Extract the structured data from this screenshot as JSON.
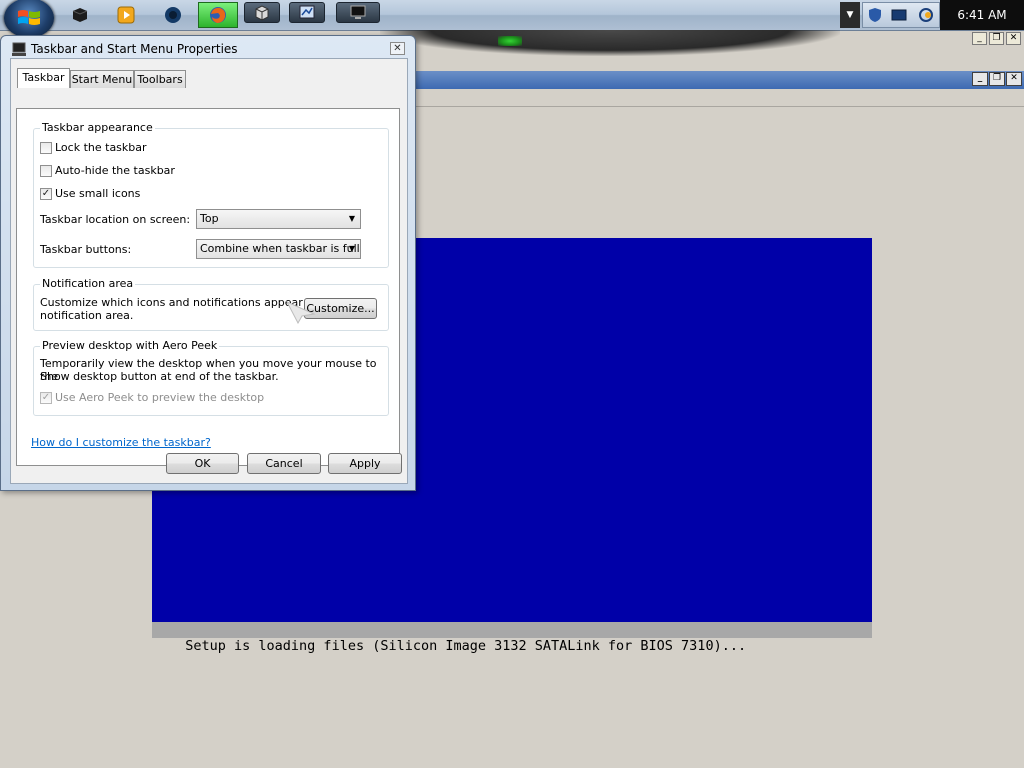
{
  "taskbar": {
    "clock": "6:41 AM",
    "icons": [
      {
        "name": "virtualbox-icon"
      },
      {
        "name": "media-player-icon"
      },
      {
        "name": "firefox-icon"
      },
      {
        "name": "network-monitor-icon"
      }
    ]
  },
  "dialog": {
    "title": "Taskbar and Start Menu Properties",
    "tabs": [
      "Taskbar",
      "Start Menu",
      "Toolbars"
    ],
    "active_tab": "Taskbar",
    "appearance": {
      "title": "Taskbar appearance",
      "lock_label": "Lock the taskbar",
      "lock_checked": false,
      "autohide_label": "Auto-hide the taskbar",
      "autohide_checked": false,
      "small_icons_label": "Use small icons",
      "small_icons_checked": true,
      "location_label": "Taskbar location on screen:",
      "location_value": "Top",
      "buttons_label": "Taskbar buttons:",
      "buttons_value": "Combine when taskbar is full"
    },
    "notification": {
      "title": "Notification area",
      "text_line1": "Customize which icons and notifications appear in the",
      "text_line2": "notification area.",
      "customize_button": "Customize..."
    },
    "aero_peek": {
      "title": "Preview desktop with Aero Peek",
      "text_line1": "Temporarily view the desktop when you move your mouse to the",
      "text_line2": "Show desktop button at end of the taskbar.",
      "checkbox_label": "Use Aero Peek to preview the desktop",
      "checkbox_checked": true,
      "checkbox_enabled": false
    },
    "help_link": "How do I customize the taskbar?",
    "buttons": {
      "ok": "OK",
      "cancel": "Cancel",
      "apply": "Apply"
    }
  },
  "vm_screen": {
    "status_text": "Setup is loading files (Silicon Image 3132 SATALink for BIOS 7310)..."
  }
}
